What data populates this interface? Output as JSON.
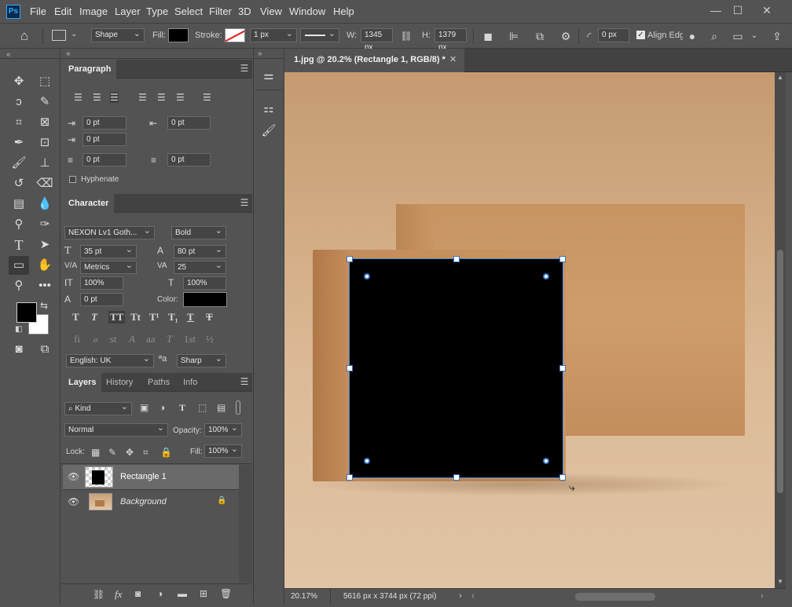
{
  "app": {
    "logo": "Ps"
  },
  "menu": [
    "File",
    "Edit",
    "Image",
    "Layer",
    "Type",
    "Select",
    "Filter",
    "3D",
    "View",
    "Window",
    "Help"
  ],
  "window_controls": [
    "—",
    "☐",
    "✕"
  ],
  "options_bar": {
    "tool_mode": "Shape",
    "fill_label": "Fill:",
    "stroke_label": "Stroke:",
    "stroke_width": "1 px",
    "w_label": "W:",
    "width": "1345 px",
    "h_label": "H:",
    "height": "1379 px",
    "corner_radius": "0 px",
    "align_edges": "Align Edges",
    "fill_color": "#000000"
  },
  "paragraph_panel": {
    "tab": "Paragraph",
    "indent_left": "0 pt",
    "indent_right": "0 pt",
    "indent_first": "0 pt",
    "space_before": "0 pt",
    "space_after": "0 pt",
    "hyphenate": "Hyphenate"
  },
  "character_panel": {
    "tab": "Character",
    "font_family": "NEXON Lv1 Goth...",
    "font_style": "Bold",
    "font_size": "35 pt",
    "leading": "80 pt",
    "kerning": "Metrics",
    "tracking": "25",
    "vertical_scale": "100%",
    "horizontal_scale": "100%",
    "baseline_shift": "0 pt",
    "color_label": "Color:",
    "language": "English: UK",
    "antialias": "Sharp",
    "text_color": "#000000"
  },
  "layers_panel": {
    "tabs": [
      "Layers",
      "History",
      "Paths",
      "Info"
    ],
    "filter": "Kind",
    "blend_mode": "Normal",
    "opacity_label": "Opacity:",
    "opacity": "100%",
    "lock_label": "Lock:",
    "fill_label": "Fill:",
    "fill": "100%",
    "layers": [
      {
        "name": "Rectangle 1",
        "selected": true
      },
      {
        "name": "Background",
        "locked": true
      }
    ]
  },
  "document": {
    "tab_title": "1.jpg @ 20.2% (Rectangle 1, RGB/8) *",
    "zoom": "20.17%",
    "info": "5616 px x 3744 px (72 ppi)"
  },
  "colors": {
    "foreground": "#000000",
    "background": "#ffffff",
    "accent": "#31a8ff",
    "selection_handle": "#4a8fd6"
  }
}
